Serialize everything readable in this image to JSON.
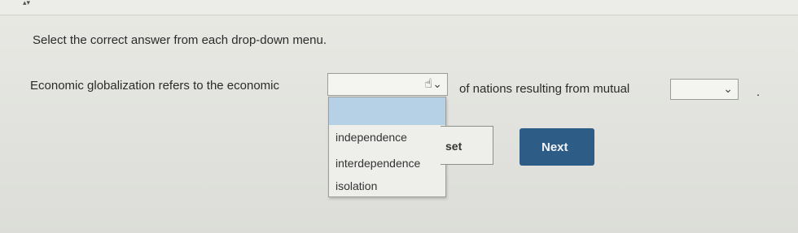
{
  "question": {
    "instruction": "Select the correct answer from each drop-down menu.",
    "sentence_part_1": "Economic globalization refers to the economic",
    "sentence_part_2": "of nations resulting from mutual",
    "sentence_end": "."
  },
  "dropdown_1": {
    "selected_value": "",
    "options": [
      "independence",
      "interdependence",
      "isolation"
    ],
    "expanded": true,
    "highlighted_index": -1
  },
  "dropdown_2": {
    "selected_value": "",
    "expanded": false
  },
  "buttons": {
    "reset_label": "set",
    "next_label": "Next"
  },
  "icons": {
    "chevron": "chevron-down-icon",
    "cursor": "hand-pointer-icon"
  },
  "colors": {
    "next_button_bg": "#2d5c86",
    "highlight_bg": "#b6d1e6"
  }
}
